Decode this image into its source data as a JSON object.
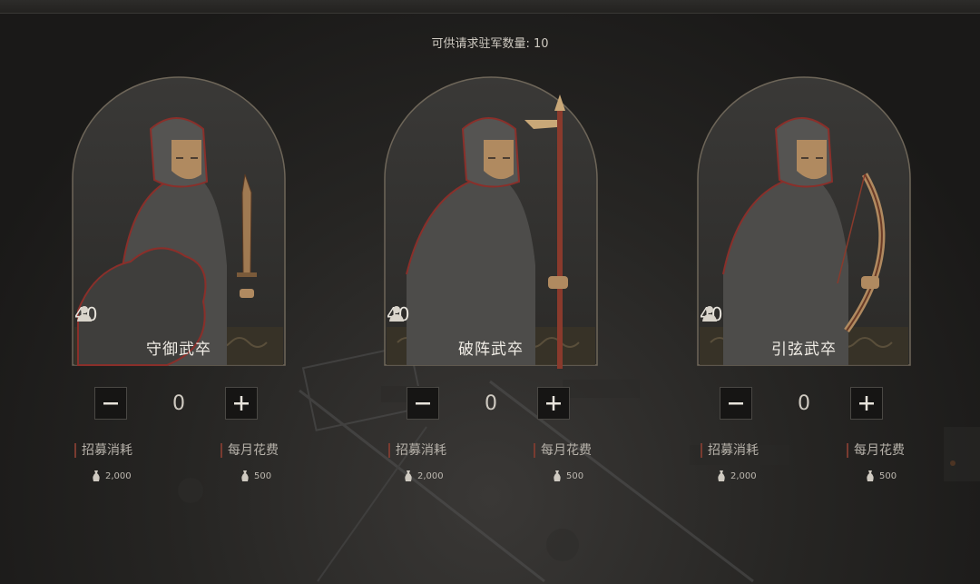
{
  "header": {
    "capacity_label": "可供请求驻军数量:",
    "capacity_value": "10"
  },
  "units": [
    {
      "name": "守御武卒",
      "weapon": "sword-and-shield",
      "strength": "40",
      "quantity": "0",
      "recruit_cost_label": "招募消耗",
      "recruit_cost_value": "2,000",
      "monthly_cost_label": "每月花费",
      "monthly_cost_value": "500"
    },
    {
      "name": "破阵武卒",
      "weapon": "halberd",
      "strength": "40",
      "quantity": "0",
      "recruit_cost_label": "招募消耗",
      "recruit_cost_value": "2,000",
      "monthly_cost_label": "每月花费",
      "monthly_cost_value": "500"
    },
    {
      "name": "引弦武卒",
      "weapon": "bow",
      "strength": "40",
      "quantity": "0",
      "recruit_cost_label": "招募消耗",
      "recruit_cost_value": "2,000",
      "monthly_cost_label": "每月花费",
      "monthly_cost_value": "500"
    }
  ],
  "icons": {
    "troop": "soldier-icon",
    "decrement": "minus-icon",
    "increment": "plus-icon",
    "currency": "coin-pouch-icon"
  },
  "colors": {
    "accent_red": "#7a3b30",
    "frame_bronze": "#8a7a62",
    "text_light": "#f1ede6"
  }
}
